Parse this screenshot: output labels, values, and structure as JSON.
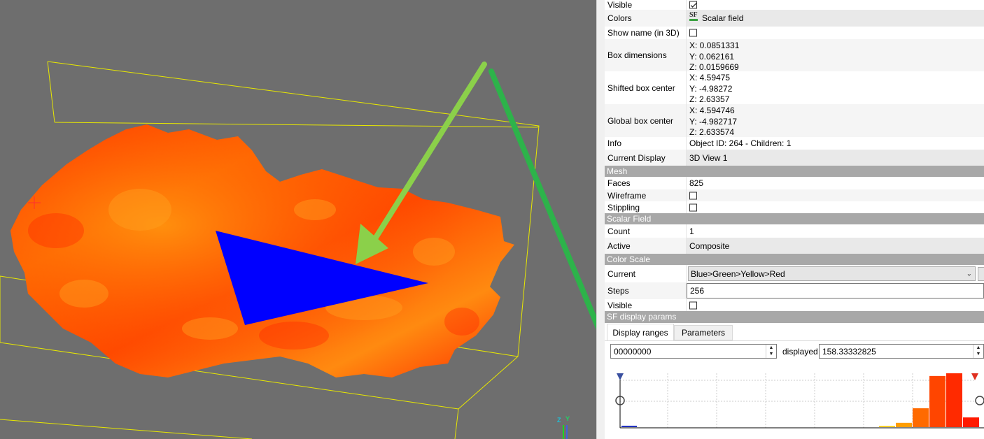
{
  "viewport": {
    "axis_labels": {
      "z": "Z",
      "y": "Y"
    },
    "background": "#6e6e6e",
    "bbox_color": "#ffff00",
    "triangle_color": "#0000ff",
    "mesh_colors": [
      "#ff3a00",
      "#ff6a00",
      "#ff9a10"
    ]
  },
  "properties": {
    "visible": {
      "label": "Visible",
      "checked": true
    },
    "colors": {
      "label": "Colors",
      "icon": "scalar-field-icon",
      "icon_text": "SF",
      "value": "Scalar field"
    },
    "show_name": {
      "label": "Show name (in 3D)",
      "checked": false
    },
    "box_dimensions": {
      "label": "Box dimensions",
      "x": "X: 0.0851331",
      "y": "Y: 0.062161",
      "z": "Z: 0.0159669"
    },
    "shifted_box_center": {
      "label": "Shifted box center",
      "x": "X: 4.59475",
      "y": "Y: -4.98272",
      "z": "Z: 2.63357"
    },
    "global_box_center": {
      "label": "Global box center",
      "x": "X: 4.594746",
      "y": "Y: -4.982717",
      "z": "Z: 2.633574"
    },
    "info": {
      "label": "Info",
      "value": "Object ID: 264 - Children: 1"
    },
    "current_display": {
      "label": "Current Display",
      "value": "3D View 1"
    }
  },
  "mesh": {
    "header": "Mesh",
    "faces": {
      "label": "Faces",
      "value": "825"
    },
    "wireframe": {
      "label": "Wireframe",
      "checked": false
    },
    "stippling": {
      "label": "Stippling",
      "checked": false
    }
  },
  "scalar_field": {
    "header": "Scalar Field",
    "count": {
      "label": "Count",
      "value": "1"
    },
    "active": {
      "label": "Active",
      "value": "Composite"
    }
  },
  "color_scale": {
    "header": "Color Scale",
    "current": {
      "label": "Current",
      "value": "Blue>Green>Yellow>Red"
    },
    "steps": {
      "label": "Steps",
      "value": "256"
    },
    "visible": {
      "label": "Visible",
      "checked": false
    }
  },
  "sf_display": {
    "header": "SF display params",
    "tabs": [
      {
        "label": "Display ranges",
        "active": true
      },
      {
        "label": "Parameters",
        "active": false
      }
    ],
    "min_value": "00000000",
    "displayed_label": "displayed",
    "displayed_value": "158.33332825"
  },
  "histogram": {
    "bar_colors": [
      "#f7c700",
      "#ff9e00",
      "#ff6a00",
      "#ff4500",
      "#ff2a00",
      "#ff1a00"
    ],
    "bar_heights": [
      0.02,
      0.08,
      0.35,
      0.95,
      1.0,
      0.18
    ],
    "marker_colors": {
      "left": "#3a50a0",
      "right": "#e03020"
    }
  },
  "annotations": {
    "arrow_light_color": "#8bd04a",
    "arrow_dark_color": "#2db34a"
  }
}
